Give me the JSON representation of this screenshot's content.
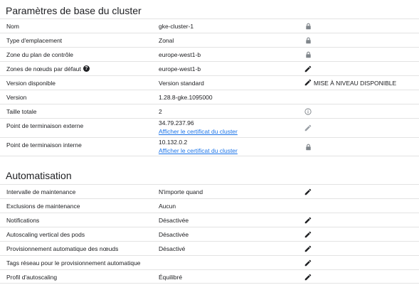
{
  "basic": {
    "title": "Paramètres de base du cluster",
    "rows": [
      {
        "label": "Nom",
        "value": "gke-cluster-1",
        "action": "lock-icon"
      },
      {
        "label": "Type d'emplacement",
        "value": "Zonal",
        "action": "lock-icon"
      },
      {
        "label": "Zone du plan de contrôle",
        "value": "europe-west1-b",
        "action": "lock-icon"
      },
      {
        "label": "Zones de nœuds par défaut",
        "value": "europe-west1-b",
        "action": "edit-icon",
        "help": "?"
      },
      {
        "label": "Version disponible",
        "value": "Version standard",
        "action": "edit-icon",
        "action_text": "MISE À NIVEAU DISPONIBLE"
      },
      {
        "label": "Version",
        "value": "1.28.8-gke.1095000",
        "action": ""
      },
      {
        "label": "Taille totale",
        "value": "2",
        "action": "info-icon"
      },
      {
        "label": "Point de terminaison externe",
        "value": "34.79.237.96",
        "link": "Afficher le certificat du cluster",
        "action": "edit-icon-disabled"
      },
      {
        "label": "Point de terminaison interne",
        "value": "10.132.0.2",
        "link": "Afficher le certificat du cluster",
        "action": "lock-icon"
      }
    ]
  },
  "automation": {
    "title": "Automatisation",
    "rows": [
      {
        "label": "Intervalle de maintenance",
        "value": "N'importe quand",
        "action": "edit-icon"
      },
      {
        "label": "Exclusions de maintenance",
        "value": "Aucun",
        "action": ""
      },
      {
        "label": "Notifications",
        "value": "Désactivée",
        "action": "edit-icon"
      },
      {
        "label": "Autoscaling vertical des pods",
        "value": "Désactivée",
        "action": "edit-icon"
      },
      {
        "label": "Provisionnement automatique des nœuds",
        "value": "Désactivé",
        "action": "edit-icon"
      },
      {
        "label": "Tags réseau pour le provisionnement automatique",
        "value": "",
        "action": "edit-icon"
      },
      {
        "label": "Profil d'autoscaling",
        "value": "Équilibré",
        "action": "edit-icon"
      }
    ]
  },
  "colors": {
    "text": "#202124",
    "link": "#1a73e8",
    "icon": "#202124",
    "icon_muted": "#80868b",
    "divider": "#e3e3e3"
  }
}
